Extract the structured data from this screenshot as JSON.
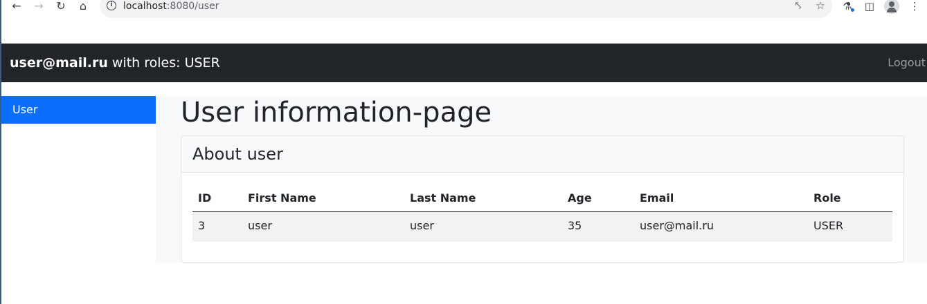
{
  "browser": {
    "url_host": "localhost",
    "url_rest": ":8080/user"
  },
  "navbar": {
    "user_email": "user@mail.ru",
    "roles_text": " with roles: USER",
    "logout_label": "Logout"
  },
  "sidebar": {
    "items": [
      {
        "label": "User",
        "active": true
      }
    ]
  },
  "main": {
    "page_title": "User information-page",
    "card_title": "About user",
    "table": {
      "columns": [
        "ID",
        "First Name",
        "Last Name",
        "Age",
        "Email",
        "Role"
      ],
      "rows": [
        [
          "3",
          "user",
          "user",
          "35",
          "user@mail.ru",
          "USER"
        ]
      ]
    }
  },
  "colors": {
    "navbar_bg": "#212529",
    "sidebar_active": "#0d6efd",
    "main_bg": "#f8f9fa"
  }
}
